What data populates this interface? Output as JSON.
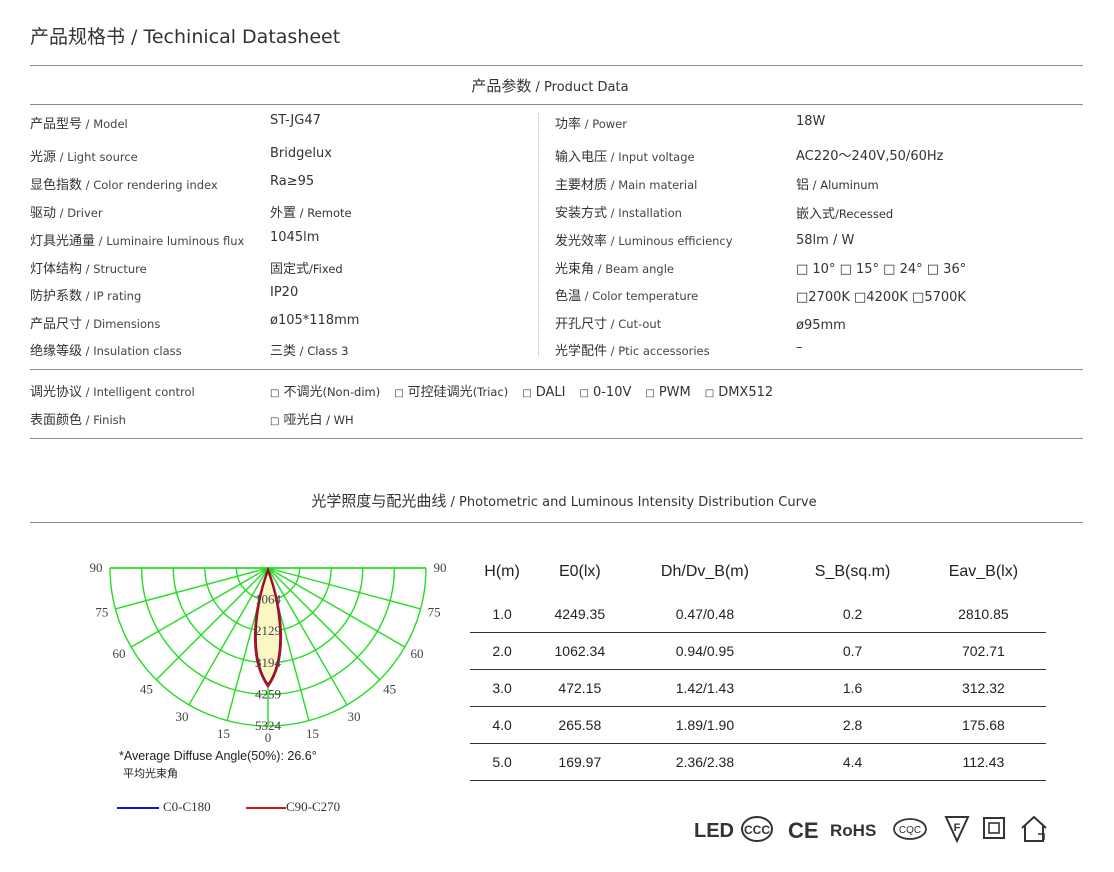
{
  "title": "产品规格书 / Techinical Datasheet",
  "product_section": {
    "zh": "产品参数",
    "en": " / Product Data"
  },
  "specs_left": [
    {
      "label_zh": "产品型号",
      "label_en": " / Model",
      "value": "ST-JG47"
    },
    {
      "label_zh": "光源",
      "label_en": " / Light source",
      "value": "Bridgelux"
    },
    {
      "label_zh": "显色指数",
      "label_en": " / Color rendering index",
      "value": "Ra≥95"
    },
    {
      "label_zh": "驱动",
      "label_en": " / Driver",
      "value_zh": "外置",
      "value_en": " / Remote"
    },
    {
      "label_zh": "灯具光通量",
      "label_en": " / Luminaire luminous flux",
      "value": "1045lm"
    },
    {
      "label_zh": "灯体结构",
      "label_en": " / Structure",
      "value_zh": "固定式",
      "value_en": "/Fixed"
    },
    {
      "label_zh": "防护系数",
      "label_en": " /  IP  rating",
      "value": "IP20"
    },
    {
      "label_zh": "产品尺寸",
      "label_en": " / Dimensions",
      "value": "ø105*118mm"
    },
    {
      "label_zh": "绝缘等级",
      "label_en": " / Insulation class",
      "value_zh": "三类",
      "value_en": " / Class 3"
    }
  ],
  "specs_right": [
    {
      "label_zh": "功率",
      "label_en": " / Power",
      "value": "18W"
    },
    {
      "label_zh": "输入电压",
      "label_en": " / Input voltage",
      "value": "AC220～240V,50/60Hz"
    },
    {
      "label_zh": "主要材质",
      "label_en": " / Main material",
      "value_zh": "铝",
      "value_en": " / Aluminum"
    },
    {
      "label_zh": "安装方式",
      "label_en": " / Installation",
      "value_zh": "嵌入式",
      "value_en": "/Recessed"
    },
    {
      "label_zh": "发光效率",
      "label_en": " / Luminous efficiency",
      "value": "58lm / W"
    },
    {
      "label_zh": "光束角",
      "label_en": " / Beam angle",
      "value": "□ 10°   □ 15°   □ 24°   □ 36°"
    },
    {
      "label_zh": "色温",
      "label_en": " / Color temperature",
      "value": "□2700K □4200K □5700K"
    },
    {
      "label_zh": "开孔尺寸",
      "label_en": " / Cut-out",
      "value": "ø95mm"
    },
    {
      "label_zh": "光学配件",
      "label_en": " / Ptic accessories",
      "value": "–"
    }
  ],
  "control": {
    "label_zh": "调光协议",
    "label_en": " /  Intelligent control",
    "options": [
      {
        "zh": "不调光",
        "en": "(Non-dim)"
      },
      {
        "zh": "可控硅调光",
        "en": "(Triac)"
      },
      {
        "zh": "DALI",
        "en": ""
      },
      {
        "zh": "0-10V",
        "en": ""
      },
      {
        "zh": "PWM",
        "en": ""
      },
      {
        "zh": "DMX512",
        "en": ""
      }
    ]
  },
  "finish": {
    "label_zh": "表面颜色",
    "label_en": " / Finish",
    "value_zh": "哑光白",
    "value_en": " / WH"
  },
  "box_glyph": "□",
  "photometric_section": {
    "zh": "光学照度与配光曲线",
    "en": " / Photometric and Luminous Intensity Distribution Curve"
  },
  "polar": {
    "angle_labels": [
      "90",
      "75",
      "60",
      "45",
      "30",
      "15",
      "0",
      "15",
      "30",
      "45",
      "60",
      "75",
      "90"
    ],
    "intensity_labels": [
      "1064",
      "2129",
      "3194",
      "4259",
      "5324"
    ],
    "grid_color": "#22dd22",
    "curve_color": "#b0102a",
    "fill_color": "#fbf7c4",
    "note": "*Average Diffuse Angle(50%): 26.6°",
    "note_zh": "平均光束角",
    "legend": [
      {
        "name": "C0-C180",
        "color": "#0a18d8"
      },
      {
        "name": "C90-C270",
        "color": "#d01818"
      }
    ]
  },
  "table": {
    "headers": [
      "H(m)",
      "E0(lx)",
      "Dh/Dv_B(m)",
      "S_B(sq.m)",
      "Eav_B(lx)"
    ],
    "rows": [
      [
        "1.0",
        "4249.35",
        "0.47/0.48",
        "0.2",
        "2810.85"
      ],
      [
        "2.0",
        "1062.34",
        "0.94/0.95",
        "0.7",
        "702.71"
      ],
      [
        "3.0",
        "472.15",
        "1.42/1.43",
        "1.6",
        "312.32"
      ],
      [
        "4.0",
        "265.58",
        "1.89/1.90",
        "2.8",
        "175.68"
      ],
      [
        "5.0",
        "169.97",
        "2.36/2.38",
        "4.4",
        "112.43"
      ]
    ]
  },
  "certifications": [
    "LED",
    "CCC",
    "CE",
    "RoHS",
    "CQC",
    "F",
    "II",
    "H"
  ]
}
